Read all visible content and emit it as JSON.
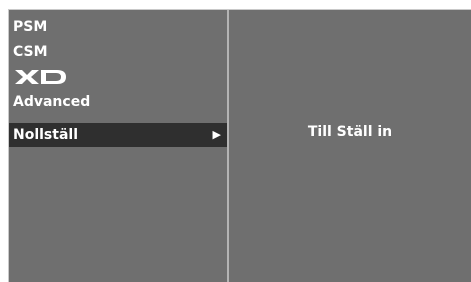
{
  "menu": {
    "items": [
      {
        "label": "PSM"
      },
      {
        "label": "CSM"
      },
      {
        "label": "XD",
        "logo": true
      },
      {
        "label": "Advanced"
      },
      {
        "label": "Nollställ",
        "selected": true,
        "arrow": "▶"
      }
    ]
  },
  "detail": {
    "text": "Till Ställ in"
  },
  "colors": {
    "panel_bg": "#6f6f6f",
    "selected_bg": "#2f2f2f",
    "divider": "#b4b4b4",
    "text": "#ffffff"
  }
}
